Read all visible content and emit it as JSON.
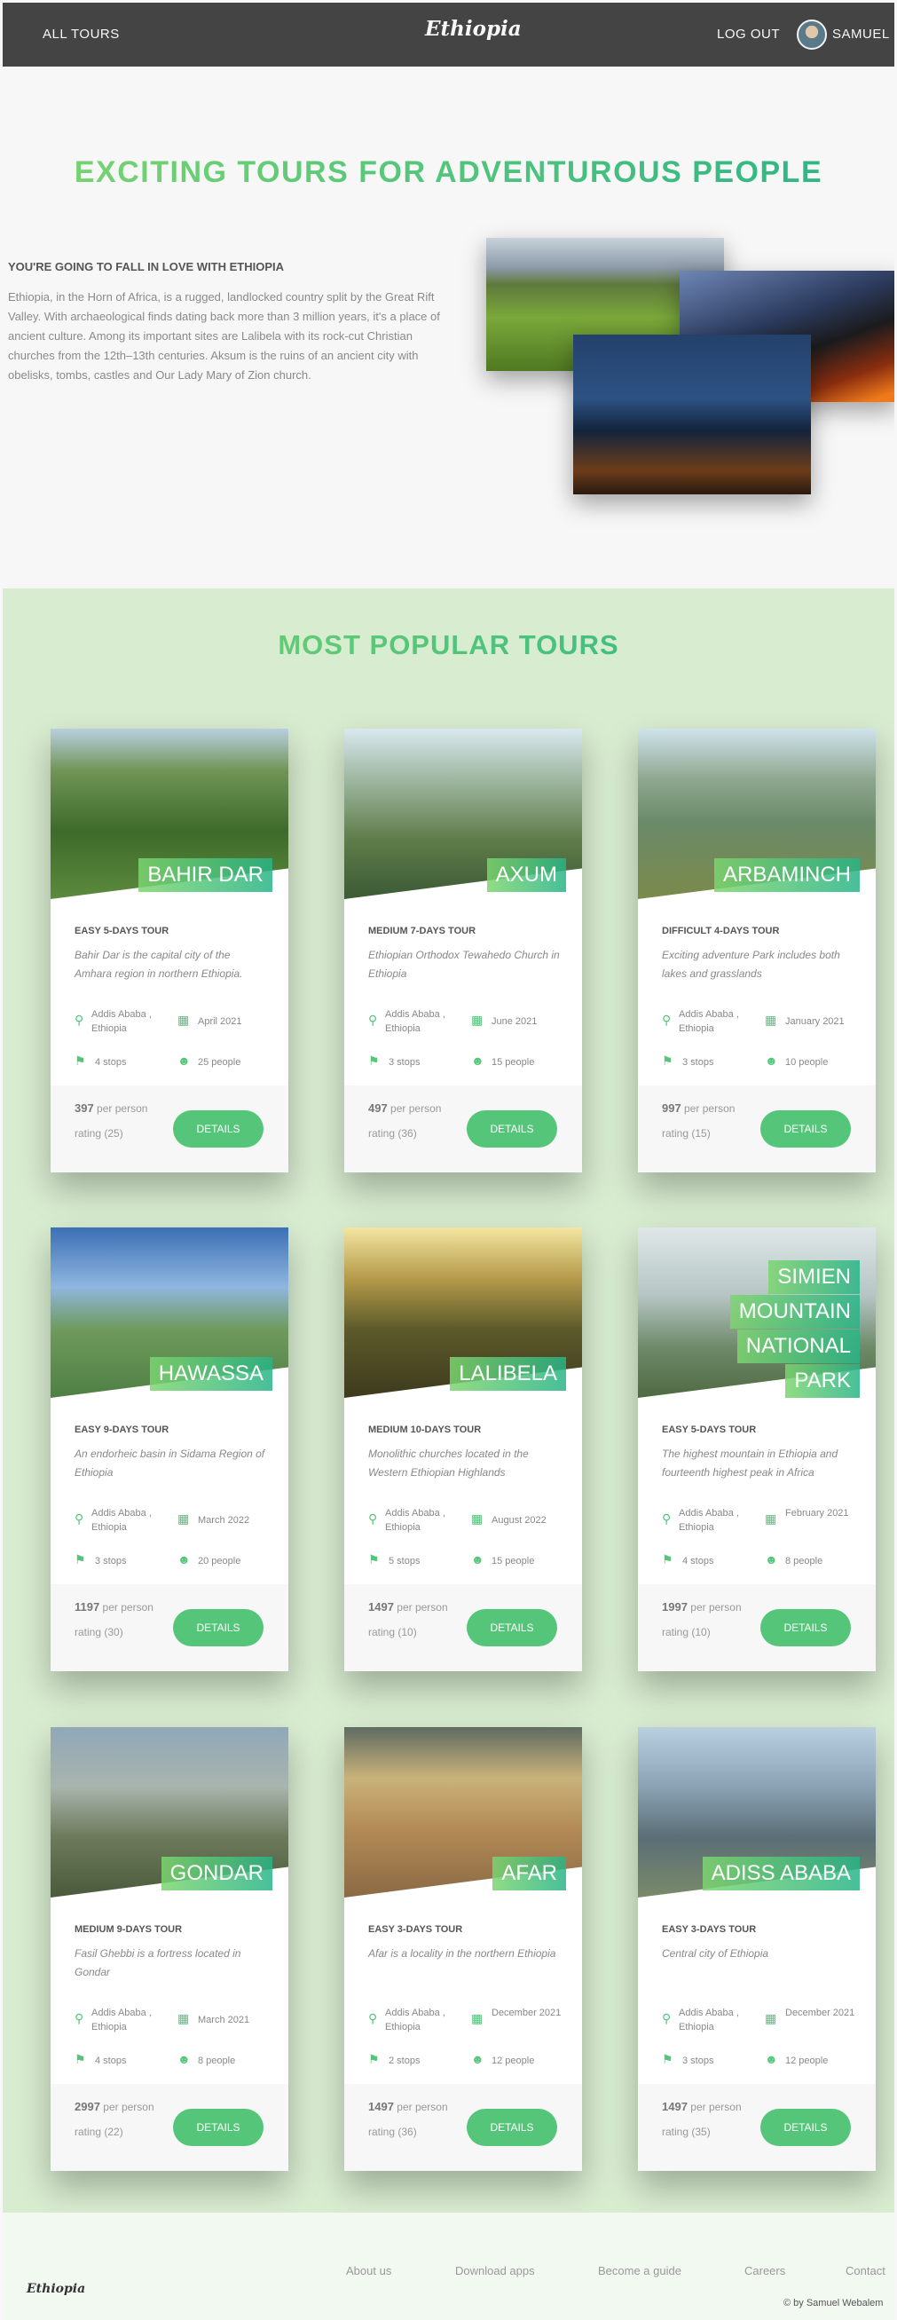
{
  "header": {
    "all_tours": "ALL TOURS",
    "logo": "Ethiopia",
    "logout": "LOG OUT",
    "user": "SAMUEL"
  },
  "intro": {
    "title": "EXCITING TOURS FOR ADVENTUROUS PEOPLE",
    "subtitle": "YOU'RE GOING TO FALL IN LOVE WITH ETHIOPIA",
    "text": "Ethiopia, in the Horn of Africa, is a rugged, landlocked country split by the Great Rift Valley. With archaeological finds dating back more than 3 million years, it's a place of ancient culture. Among its important sites are Lalibela with its rock-cut Christian churches from the 12th–13th centuries. Aksum is the ruins of an ancient city with obelisks, tombs, castles and Our Lady Mary of Zion church."
  },
  "popular_title": "MOST POPULAR TOURS",
  "tours": [
    {
      "name": "BAHIR DAR",
      "sub": "EASY 5-DAYS TOUR",
      "summary": "Bahir Dar is the capital city of the Amhara region in northern Ethiopia.",
      "location": "Addis Ababa , Ethiopia",
      "date": "April 2021",
      "stops": "4 stops",
      "people": "25 people",
      "price": "397",
      "per": "per person",
      "rating": "rating (25)",
      "button": "DETAILS"
    },
    {
      "name": "AXUM",
      "sub": "MEDIUM 7-DAYS TOUR",
      "summary": "Ethiopian Orthodox Tewahedo Church in Ethiopia",
      "location": "Addis Ababa , Ethiopia",
      "date": "June 2021",
      "stops": "3 stops",
      "people": "15 people",
      "price": "497",
      "per": "per person",
      "rating": "rating (36)",
      "button": "DETAILS"
    },
    {
      "name": "ARBAMINCH",
      "sub": "DIFFICULT 4-DAYS TOUR",
      "summary": "Exciting adventure Park includes both lakes and grasslands",
      "location": "Addis Ababa , Ethiopia",
      "date": "January 2021",
      "stops": "3 stops",
      "people": "10 people",
      "price": "997",
      "per": "per person",
      "rating": "rating (15)",
      "button": "DETAILS"
    },
    {
      "name": "HAWASSA",
      "sub": "EASY 9-DAYS TOUR",
      "summary": "An endorheic basin in Sidama Region of Ethiopia",
      "location": "Addis Ababa , Ethiopia",
      "date": "March 2022",
      "stops": "3 stops",
      "people": "20 people",
      "price": "1197",
      "per": "per person",
      "rating": "rating (30)",
      "button": "DETAILS"
    },
    {
      "name": "LALIBELA",
      "sub": "MEDIUM 10-DAYS TOUR",
      "summary": "Monolithic churches located in the Western Ethiopian Highlands",
      "location": "Addis Ababa , Ethiopia",
      "date": "August 2022",
      "stops": "5 stops",
      "people": "15 people",
      "price": "1497",
      "per": "per person",
      "rating": "rating (10)",
      "button": "DETAILS"
    },
    {
      "name": "SIMIEN MOUNTAIN NATIONAL PARK",
      "sub": "EASY 5-DAYS TOUR",
      "summary": "The highest mountain in Ethiopia and fourteenth highest peak in Africa",
      "location": "Addis Ababa , Ethiopia",
      "date": "February 2021",
      "stops": "4 stops",
      "people": "8 people",
      "price": "1997",
      "per": "per person",
      "rating": "rating (10)",
      "button": "DETAILS"
    },
    {
      "name": "GONDAR",
      "sub": "MEDIUM 9-DAYS TOUR",
      "summary": "Fasil Ghebbi is a fortress located in Gondar",
      "location": "Addis Ababa , Ethiopia",
      "date": "March 2021",
      "stops": "4 stops",
      "people": "8 people",
      "price": "2997",
      "per": "per person",
      "rating": "rating (22)",
      "button": "DETAILS"
    },
    {
      "name": "AFAR",
      "sub": "EASY 3-DAYS TOUR",
      "summary": "Afar is a locality in the northern Ethiopia",
      "location": "Addis Ababa , Ethiopia",
      "date": "December 2021",
      "stops": "2 stops",
      "people": "12 people",
      "price": "1497",
      "per": "per person",
      "rating": "rating (36)",
      "button": "DETAILS"
    },
    {
      "name": "ADISS ABABA",
      "sub": "EASY 3-DAYS TOUR",
      "summary": "Central city of Ethiopia",
      "location": "Addis Ababa , Ethiopia",
      "date": "December 2021",
      "stops": "3 stops",
      "people": "12 people",
      "price": "1497",
      "per": "per person",
      "rating": "rating (35)",
      "button": "DETAILS"
    }
  ],
  "footer": {
    "logo": "Ethiopia",
    "nav": [
      "About us",
      "Download apps",
      "Become a guide",
      "Careers",
      "Contact"
    ],
    "copyright": "© by Samuel Webalem"
  },
  "colors": {
    "accent": "#55c57a",
    "accent_light": "#7dd56f",
    "accent_dark": "#28b487",
    "header_bg": "#444444"
  }
}
